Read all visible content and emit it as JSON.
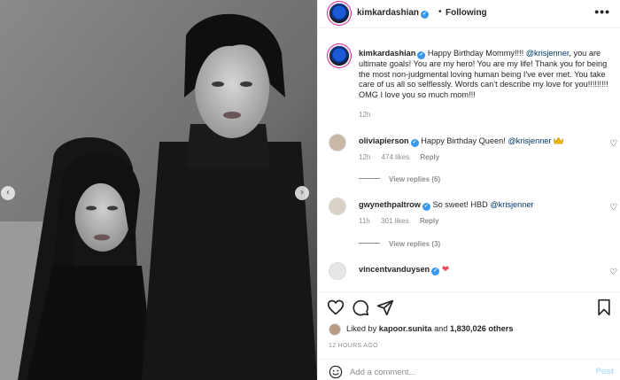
{
  "header": {
    "username": "kimkardashian",
    "separator": "•",
    "follow_status": "Following",
    "more": "•••"
  },
  "caption": {
    "username": "kimkardashian",
    "text_before": "Happy Birthday Mommy!!!! ",
    "mention": "@krisjenner",
    "text_after": ", you are ultimate goals! You are my hero! You are my life! Thank you for being the most non-judgmental loving human being I've ever met. You take care of us all so selflessly. Words can't describe my love for you!!!!!!!!! OMG I love you so much mom!!!",
    "time": "12h"
  },
  "comments": [
    {
      "username": "oliviapierson",
      "text": "Happy Birthday Queen! ",
      "mention": "@krisjenner",
      "emoji": "crown",
      "time": "12h",
      "likes": "474 likes",
      "reply": "Reply",
      "view_replies": "View replies (6)"
    },
    {
      "username": "gwynethpaltrow",
      "text": "So sweet! HBD ",
      "mention": "@krisjenner",
      "time": "11h",
      "likes": "301 likes",
      "reply": "Reply",
      "view_replies": "View replies (3)"
    },
    {
      "username": "vincentvanduysen",
      "emoji": "red-heart"
    }
  ],
  "likes": {
    "prefix": "Liked by ",
    "user": "kapoor.sunita",
    "middle": " and ",
    "count": "1,830,026 others"
  },
  "time_ago": "12 HOURS AGO",
  "add_comment": {
    "placeholder": "Add a comment...",
    "post_label": "Post"
  },
  "icons": {
    "verified": "verified-badge-icon",
    "like": "heart-icon",
    "comment": "comment-icon",
    "share": "share-icon",
    "save": "bookmark-icon",
    "emoji": "smiley-icon",
    "prev": "chevron-left-icon",
    "next": "chevron-right-icon"
  },
  "colors": {
    "verified": "#3897f0",
    "mention": "#00376b",
    "muted": "#8e8e8e",
    "heart": "#ed4956",
    "post_disabled": "#b2dffc"
  },
  "photo": {
    "nav_prev": "‹",
    "nav_next": "›"
  }
}
